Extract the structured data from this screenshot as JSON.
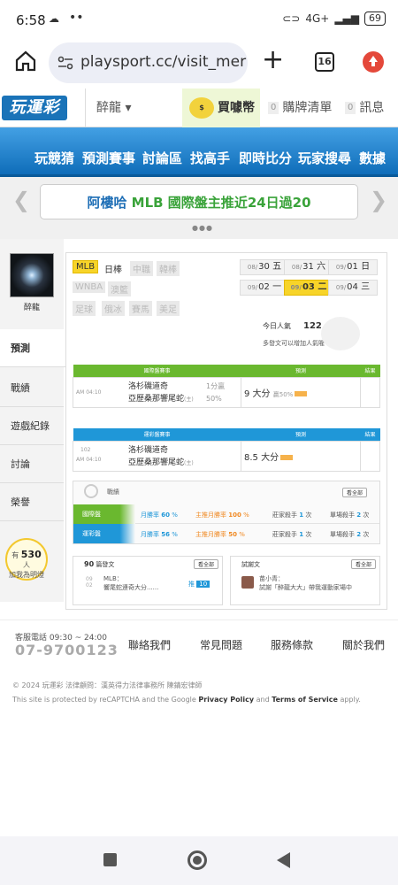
{
  "status": {
    "time": "6:58",
    "battery": "69",
    "net": "4G+"
  },
  "browser": {
    "url": "playsport.cc/visit_mer",
    "tab_count": "16"
  },
  "site": {
    "logo": "玩運彩",
    "username": "醉龍",
    "coin_label": "買噱幣",
    "cart_count": "0",
    "cart_label": "購牌清單",
    "msg_count": "0",
    "msg_label": "訊息"
  },
  "nav": [
    "玩競猜",
    "預測賽事",
    "討論區",
    "找高手",
    "即時比分",
    "玩家搜尋",
    "數據"
  ],
  "banner": {
    "prefix": "阿樓哈 ",
    "highlight": "MLB 國際盤主推近24日過20",
    "dots": "●●●"
  },
  "sidebar": {
    "avatar_name": "醉龍",
    "items": [
      "預測",
      "戰績",
      "遊戲紀錄",
      "討論",
      "榮譽"
    ],
    "bulb_count": "530",
    "bulb_unit": "人",
    "bulb_text": "加我為明燈",
    "bulb_pre": "有"
  },
  "leagues": [
    "MLB",
    "日棒",
    "中職",
    "韓棒",
    "WNBA",
    "澳籃",
    "足球",
    "俄冰",
    "賽馬",
    "美足"
  ],
  "dates": [
    {
      "m": "08/",
      "d": "30 五"
    },
    {
      "m": "08/",
      "d": "31 六"
    },
    {
      "m": "09/",
      "d": "01 日"
    },
    {
      "m": "09/",
      "d": "02 一"
    },
    {
      "m": "09/",
      "d": "03 二"
    },
    {
      "m": "09/",
      "d": "04 三"
    }
  ],
  "stats": {
    "today_label": "今日人氣",
    "today_value": "122",
    "hint": "多發文可以增加人氣喔~"
  },
  "intl": {
    "headers": [
      "國際盤賽事",
      "預測",
      "結果"
    ],
    "time": "AM 04:10",
    "away": "洛杉磯道奇",
    "home": "亞歷桑那響尾蛇",
    "home_tag": "(主)",
    "line": "1分贏",
    "pct": "50%",
    "pick": "9 大分",
    "pick_note": "贏50%"
  },
  "lottery": {
    "headers": [
      "運彩盤賽事",
      "預測",
      "結果"
    ],
    "no": "102",
    "time": "AM 04:10",
    "away": "洛杉磯道奇",
    "home": "亞歷桑那響尾蛇",
    "home_tag": "(主)",
    "pick": "8.5 大分"
  },
  "record": {
    "title": "戰績",
    "all": "看全部",
    "rows": [
      {
        "label": "國際盤",
        "monthly": "月勝率",
        "m_val": "60",
        "push": "主推月勝率",
        "p_val": "100",
        "home": "莊家殺手",
        "h_val": "1",
        "single": "單場殺手",
        "s_val": "2",
        "unit": "次",
        "pct": "%"
      },
      {
        "label": "運彩盤",
        "monthly": "月勝率",
        "m_val": "56",
        "push": "主推月勝率",
        "p_val": "50",
        "home": "莊家殺手",
        "h_val": "1",
        "single": "單場殺手",
        "s_val": "2",
        "unit": "次",
        "pct": "%"
      }
    ]
  },
  "posts": {
    "count": "90",
    "label": "篇發文",
    "all": "看全部",
    "date": "09 02",
    "league": "MLB：",
    "title": "響尾蛇連奇大分......",
    "badge_pre": "推",
    "badge": "10"
  },
  "visitors": {
    "label": "試謝文",
    "all": "看全部",
    "name": "苗小青：",
    "text": "試謝「醉龍大大」帶我運動家場中"
  },
  "footer": {
    "svc": "客服電話 09:30 ~ 24:00",
    "tel": "07-9700123",
    "links": [
      "聯絡我們",
      "常見問題",
      "服務條款",
      "關於我們"
    ],
    "copy": "© 2024 玩運彩 法律顧問：漢英得力法律事務所 陳錆宏律師",
    "recaptcha_a": "This site is protected by reCAPTCHA and the Google ",
    "pp": "Privacy Policy",
    "and": " and ",
    "tos": "Terms of Service",
    "apply": " apply."
  }
}
